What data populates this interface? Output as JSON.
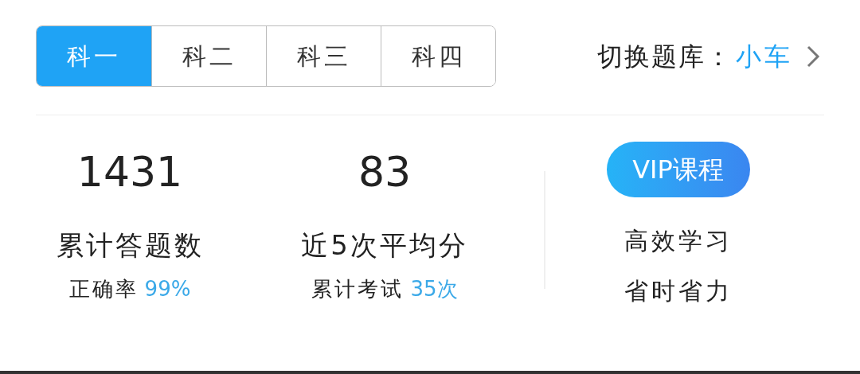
{
  "tabs": [
    {
      "label": "科一",
      "selected": true
    },
    {
      "label": "科二",
      "selected": false
    },
    {
      "label": "科三",
      "selected": false
    },
    {
      "label": "科四",
      "selected": false
    }
  ],
  "bank_switch": {
    "label": "切换题库：",
    "value": "小车"
  },
  "stats": [
    {
      "value": "1431",
      "label": "累计答题数",
      "sub_label": "正确率",
      "sub_value": "99%"
    },
    {
      "value": "83",
      "label": "近5次平均分",
      "sub_label": "累计考试",
      "sub_value": "35次"
    }
  ],
  "promo": {
    "button": "VIP课程",
    "lines": [
      "高效学习",
      "省时省力"
    ]
  }
}
